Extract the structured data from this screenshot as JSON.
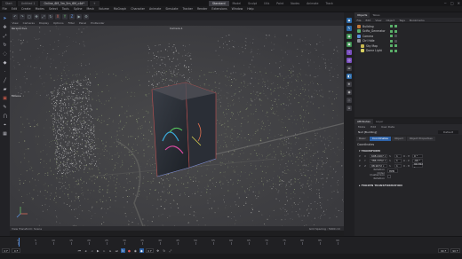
{
  "titlebar": {
    "tabs": [
      "Start",
      "Untitled 1",
      "Online_6M_3m_5m_6M_c4d*"
    ],
    "active_tab": 2,
    "layouts": [
      "Standard",
      "Model",
      "Sculpt",
      "UVs",
      "Paint",
      "Nodes",
      "Animate",
      "Track"
    ],
    "active_layout": 0,
    "window_controls": [
      "−",
      "□",
      "✕"
    ]
  },
  "menubar": {
    "items": [
      "File",
      "Edit",
      "Create",
      "Modes",
      "Select",
      "Tools",
      "Spline",
      "Mesh",
      "Volume",
      "MoGraph",
      "Character",
      "Animate",
      "Simulate",
      "Tracker",
      "Render",
      "Extensions",
      "Window",
      "Help"
    ]
  },
  "viewport": {
    "menu": [
      "View",
      "Cameras",
      "Display",
      "Options",
      "Filter",
      "Panel",
      "ProRender"
    ],
    "name": "Perspective",
    "camera": "Camera.1",
    "status_left": "View Transform: Scene",
    "status_right": "Grid Spacing : 5000 cm"
  },
  "object_manager": {
    "tabs": [
      "Objects",
      "Takes"
    ],
    "active_tab": 0,
    "menu": [
      "File",
      "Edit",
      "View",
      "Object",
      "Tags",
      "Bookmarks"
    ],
    "objects": [
      {
        "name": "Building",
        "indent": 0,
        "color": "#c47a3a",
        "tags": 2
      },
      {
        "name": "Scifio_Generator",
        "indent": 0,
        "color": "#5bb06a",
        "tags": 2
      },
      {
        "name": "Camera",
        "indent": 0,
        "color": "#5b8fd9",
        "tags": 1
      },
      {
        "name": "Ctrl Hdle",
        "indent": 0,
        "color": "#8a8a90",
        "tags": 1
      },
      {
        "name": "Sky Map",
        "indent": 1,
        "color": "#c8b850",
        "tags": 2
      },
      {
        "name": "Dome Light",
        "indent": 1,
        "color": "#d8d060",
        "tags": 2
      }
    ]
  },
  "attributes": {
    "tabs": [
      "Attributes",
      "Layer"
    ],
    "active_tab": 0,
    "mode_items": [
      "Mode",
      "Edit",
      "User Data"
    ],
    "object_label": "Null [Building]",
    "preset": "Default",
    "subtabs": [
      "Basic",
      "Coordinates",
      "Object",
      "Object Properties"
    ],
    "active_subtab": 1,
    "section": "Coordinates",
    "subsection": "TRANSFORM",
    "rows": [
      {
        "axis": "P",
        "sub": "X",
        "value": "608.2407 c",
        "r_lbl": "S",
        "r_val": "1",
        "rot": "R . H",
        "rot_val": "0 °"
      },
      {
        "axis": "P",
        "sub": "Y",
        "value": "386.3352 c",
        "r_lbl": "S",
        "r_val": "1",
        "rot": "R . P",
        "rot_val": "-90 °"
      },
      {
        "axis": "P",
        "sub": "Z",
        "value": "98.9272 c",
        "r_lbl": "S",
        "r_val": "1",
        "rot": "R . B",
        "rot_val": "90.762 °"
      }
    ],
    "rotation_order_label": "Rotation Order",
    "rotation_order_value": "HPB",
    "quaternion_label": "Quaternion Rotation",
    "frozen_label": "FROZEN TRANSFORMATION"
  },
  "timeline": {
    "ticks": [
      "0",
      "5",
      "10",
      "15",
      "20",
      "25",
      "30",
      "35",
      "40",
      "45",
      "50",
      "55",
      "60",
      "65",
      "70",
      "75",
      "80",
      "85",
      "90"
    ],
    "frame_start": "0 F",
    "frame_current": "0 F",
    "frame_end": "90 F",
    "frame_end2": "90 F",
    "current_label": "0 F"
  }
}
